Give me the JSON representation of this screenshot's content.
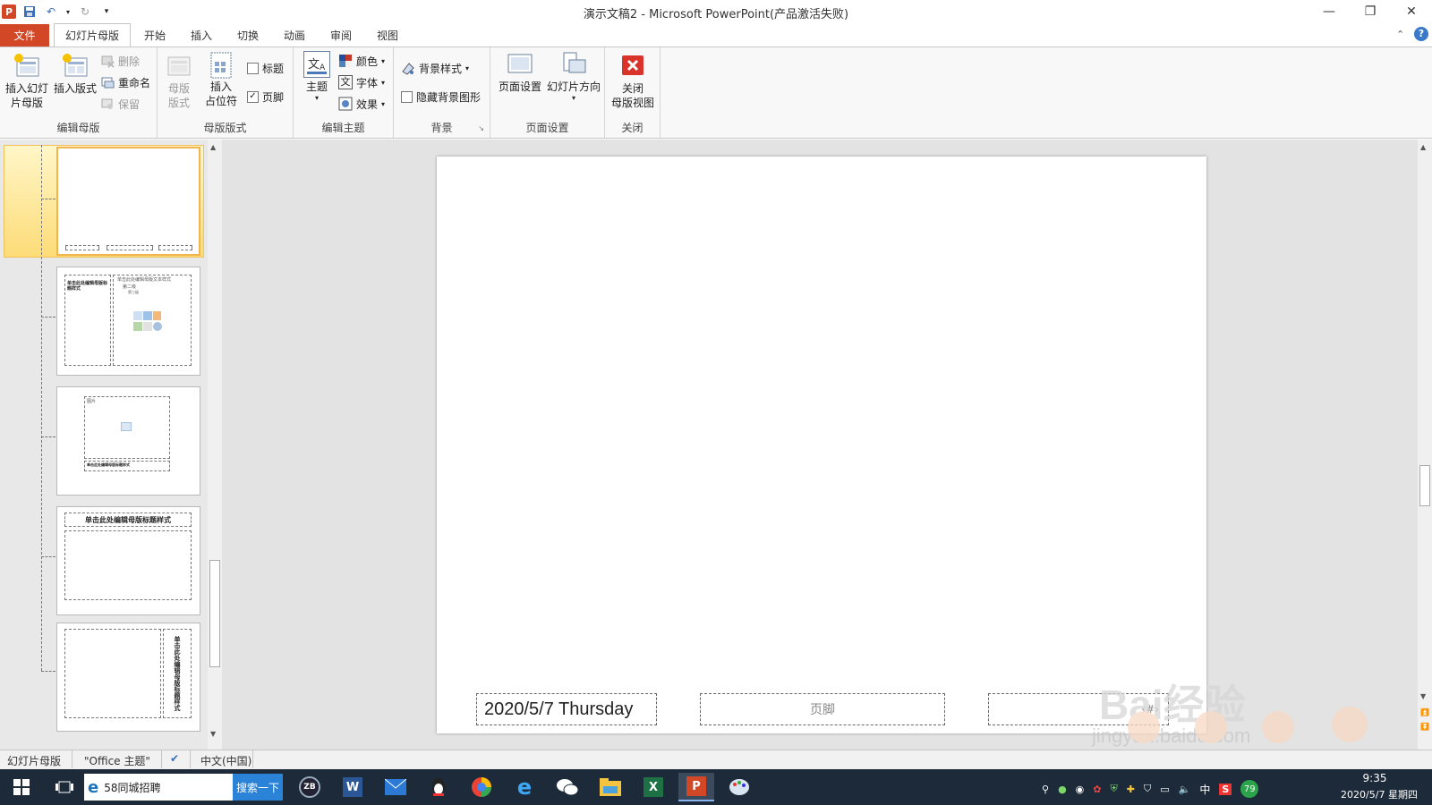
{
  "window": {
    "title": "演示文稿2  -  Microsoft PowerPoint(产品激活失败)",
    "minimize_icon": "minimize-icon",
    "restore_icon": "restore-icon",
    "close_icon": "close-icon"
  },
  "tabs": [
    {
      "label": "文件"
    },
    {
      "label": "幻灯片母版"
    },
    {
      "label": "开始"
    },
    {
      "label": "插入"
    },
    {
      "label": "切换"
    },
    {
      "label": "动画"
    },
    {
      "label": "审阅"
    },
    {
      "label": "视图"
    }
  ],
  "ribbon": {
    "edit_master": {
      "label": "编辑母版",
      "insert_slide_master": "插入幻灯\n片母版",
      "insert_layout": "插入版式",
      "delete": "删除",
      "rename": "重命名",
      "preserve": "保留"
    },
    "master_layout": {
      "label": "母版版式",
      "master_layout_btn": "母版\n版式",
      "insert_placeholder": "插入\n占位符",
      "title_check": "标题",
      "footer_check": "页脚"
    },
    "edit_theme": {
      "label": "编辑主题",
      "themes": "主题",
      "colors": "颜色",
      "fonts": "字体",
      "effects": "效果"
    },
    "background": {
      "label": "背景",
      "background_styles": "背景样式",
      "hide_background": "隐藏背景图形"
    },
    "page_setup": {
      "label": "页面设置",
      "page_setup_btn": "页面设置",
      "slide_orientation": "幻灯片方向"
    },
    "close": {
      "label": "关闭",
      "close_master": "关闭\n母版视图"
    }
  },
  "thumbnails": {
    "t2_title": "单击此处编辑母版标题样式",
    "t2_body": "单击此处编辑母版文本样式",
    "t2_level2": "第二级",
    "t2_level3": "第三级",
    "t3_label": "图片",
    "t3_caption": "单击此处编辑母版标题样式",
    "t4_title": "单击此处编辑母版标题样式",
    "t5_title": "单击此处编辑母版标题样式",
    "date_small": "2020/5/7 Thursday"
  },
  "slide": {
    "date": "2020/5/7 Thursday",
    "footer": "页脚",
    "number": "‹#›"
  },
  "status": {
    "view": "幻灯片母版",
    "theme": "\"Office 主题\"",
    "language": "中文(中国)"
  },
  "taskbar": {
    "search_text": "58同城招聘",
    "search_button": "搜索一下",
    "time": "9:35",
    "date": "2020/5/7 星期四",
    "ime": "中",
    "badge": "79"
  },
  "watermark": {
    "text": "Bai经验",
    "url": "jingyan.baidu.com"
  },
  "colors": {
    "accent": "#d24726",
    "ribbon_bg": "#f8f8f8",
    "canvas_bg": "#e3e3e3",
    "taskbar_bg": "#1c2a3a",
    "selected_thumb": "#f2b44f"
  }
}
